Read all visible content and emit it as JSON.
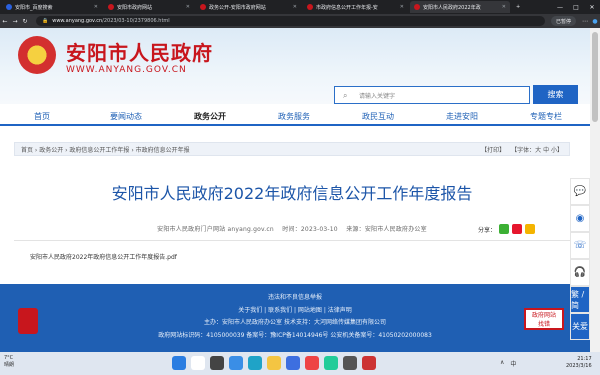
{
  "browser": {
    "tabs": [
      {
        "label": "安阳市_百度搜索",
        "color": "#2a61e0",
        "active": false
      },
      {
        "label": "安阳市政府网站",
        "color": "#c8161d",
        "active": false
      },
      {
        "label": "政务公开-安阳市政府网站",
        "color": "#c8161d",
        "active": false
      },
      {
        "label": "市政府信息公开工作年报-安",
        "color": "#c8161d",
        "active": false
      },
      {
        "label": "安阳市人民政府2022年政",
        "color": "#c8161d",
        "active": true
      }
    ],
    "url_domain": "www.anyang.gov.cn",
    "url_path": "/2023/03-10/2379806.html",
    "paused_label": "已暂停",
    "window_controls": [
      "—",
      "□",
      "✕"
    ]
  },
  "header": {
    "title": "安阳市人民政府",
    "subtitle": "WWW.ANYANG.GOV.CN",
    "search_placeholder": "请输入关键字",
    "search_button": "搜索"
  },
  "nav": {
    "items": [
      "首页",
      "要闻动态",
      "政务公开",
      "政务服务",
      "政民互动",
      "走进安阳",
      "专题专栏"
    ],
    "active_index": 2
  },
  "breadcrumb": {
    "path": "首页 › 政务公开 › 政府信息公开工作年报 › 市政府信息公开年报",
    "print": "【打印】",
    "font_label": "【字体：",
    "font_sizes": "大 中 小】"
  },
  "article": {
    "title": "安阳市人民政府2022年政府信息公开工作年度报告",
    "source_site": "安阳市人民政府门户网站 anyang.gov.cn",
    "date_label": "时间：",
    "date": "2023-03-10",
    "origin_label": "来源：",
    "origin": "安阳市人民政府办公室",
    "share_label": "分享：",
    "attachment": "安阳市人民政府2022年政府信息公开工作年度报告.pdf"
  },
  "side_tools": {
    "chat_icon": "message-icon",
    "weibo_icon": "weibo-icon",
    "phone_icon": "phone-icon",
    "headset_icon": "headset-icon",
    "lang_label": "繁 / 简",
    "care_label": "关爱"
  },
  "footer": {
    "line1": "违法和不良信息举报",
    "line2": "关于我们 | 联系我们 | 网站地图 | 法律声明",
    "line3": "主办：安阳市人民政府办公室    技术支持：大河网络传媒集团有限公司",
    "line4": "政府网站标识码：4105000039    备案号：豫ICP备14014946号    公安机关备案号：41050202000083",
    "badge_line1": "政府网站",
    "badge_line2": "找错"
  },
  "taskbar": {
    "temp": "7°C",
    "weather": "晴朗",
    "time": "21:17",
    "date": "2023/3/16",
    "lang": "中",
    "tray": [
      "∧",
      "中"
    ]
  }
}
